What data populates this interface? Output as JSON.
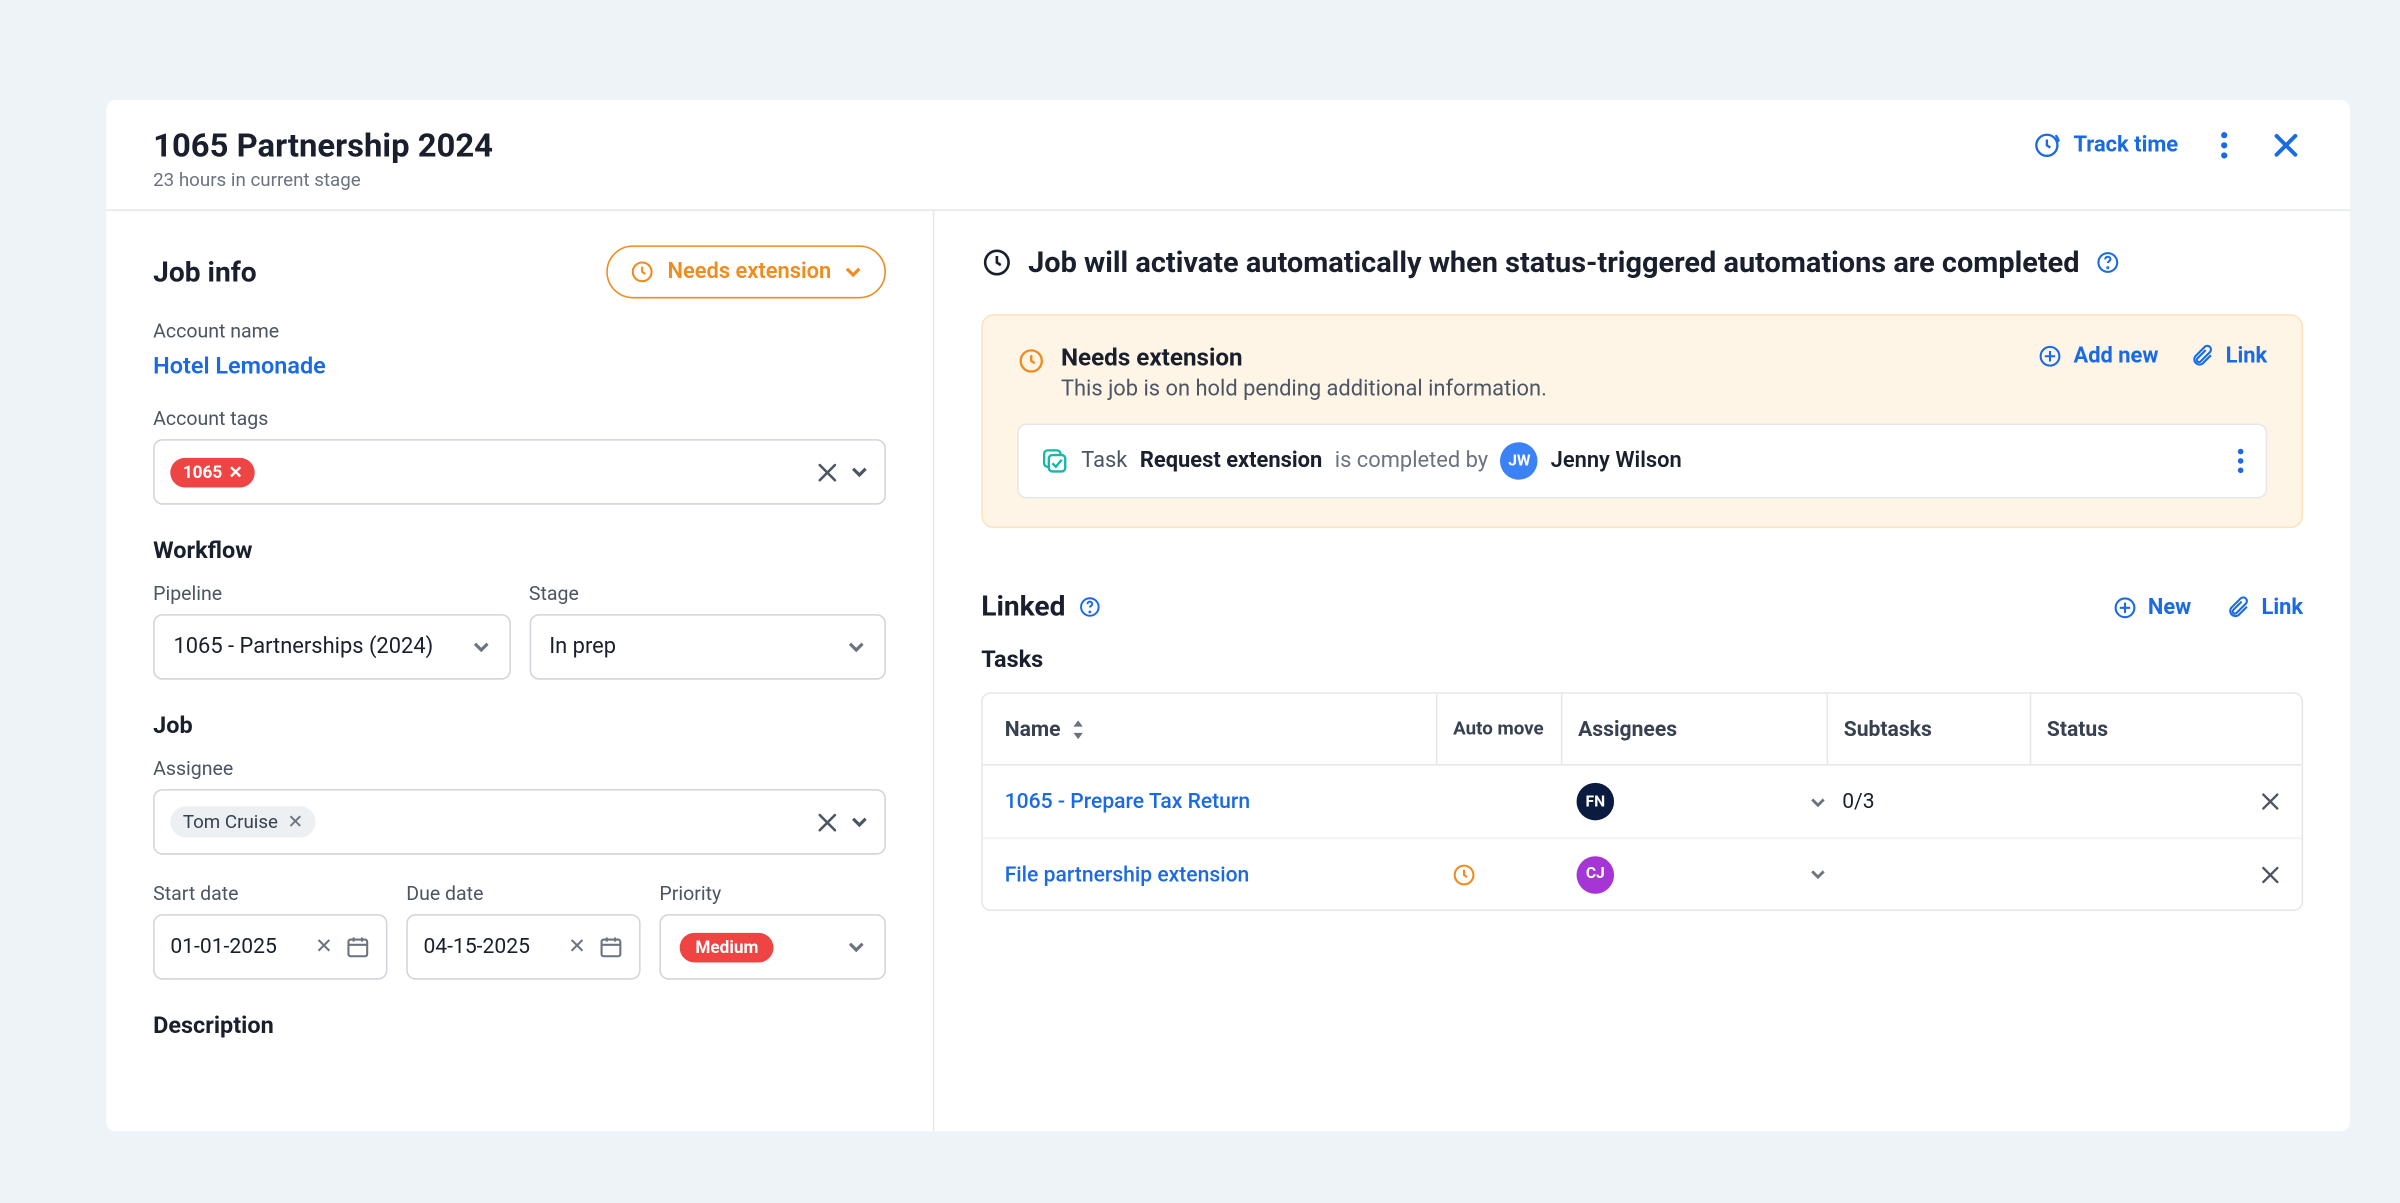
{
  "header": {
    "title": "1065 Partnership 2024",
    "subtitle": "23 hours in current stage",
    "track_time": "Track time"
  },
  "left": {
    "section": "Job info",
    "status": "Needs extension",
    "account_name_label": "Account name",
    "account_name": "Hotel Lemonade",
    "account_tags_label": "Account tags",
    "tag1": "1065",
    "workflow_head": "Workflow",
    "pipeline_label": "Pipeline",
    "pipeline_value": "1065 - Partnerships (2024)",
    "stage_label": "Stage",
    "stage_value": "In prep",
    "job_head": "Job",
    "assignee_label": "Assignee",
    "assignee_value": "Tom Cruise",
    "start_date_label": "Start date",
    "start_date_value": "01-01-2025",
    "due_date_label": "Due date",
    "due_date_value": "04-15-2025",
    "priority_label": "Priority",
    "priority_value": "Medium",
    "description_head": "Description"
  },
  "right": {
    "banner": "Job will activate automatically when status-triggered automations are completed",
    "alert_title": "Needs extension",
    "alert_desc": "This job is on hold pending additional information.",
    "add_new": "Add new",
    "link": "Link",
    "task_label": "Task",
    "task_name": "Request extension",
    "task_completed_by": "is completed by",
    "task_user_initials": "JW",
    "task_user": "Jenny Wilson",
    "linked_title": "Linked",
    "new_label": "New",
    "tasks_label": "Tasks",
    "cols": {
      "name": "Name",
      "automove": "Auto move",
      "assignees": "Assignees",
      "subtasks": "Subtasks",
      "status": "Status"
    },
    "rows": [
      {
        "name": "1065 - Prepare Tax Return",
        "automove": false,
        "avatar": "FN",
        "avclass": "av-fn",
        "subtasks": "0/3"
      },
      {
        "name": "File partnership extension",
        "automove": true,
        "avatar": "CJ",
        "avclass": "av-cj",
        "subtasks": ""
      }
    ]
  }
}
